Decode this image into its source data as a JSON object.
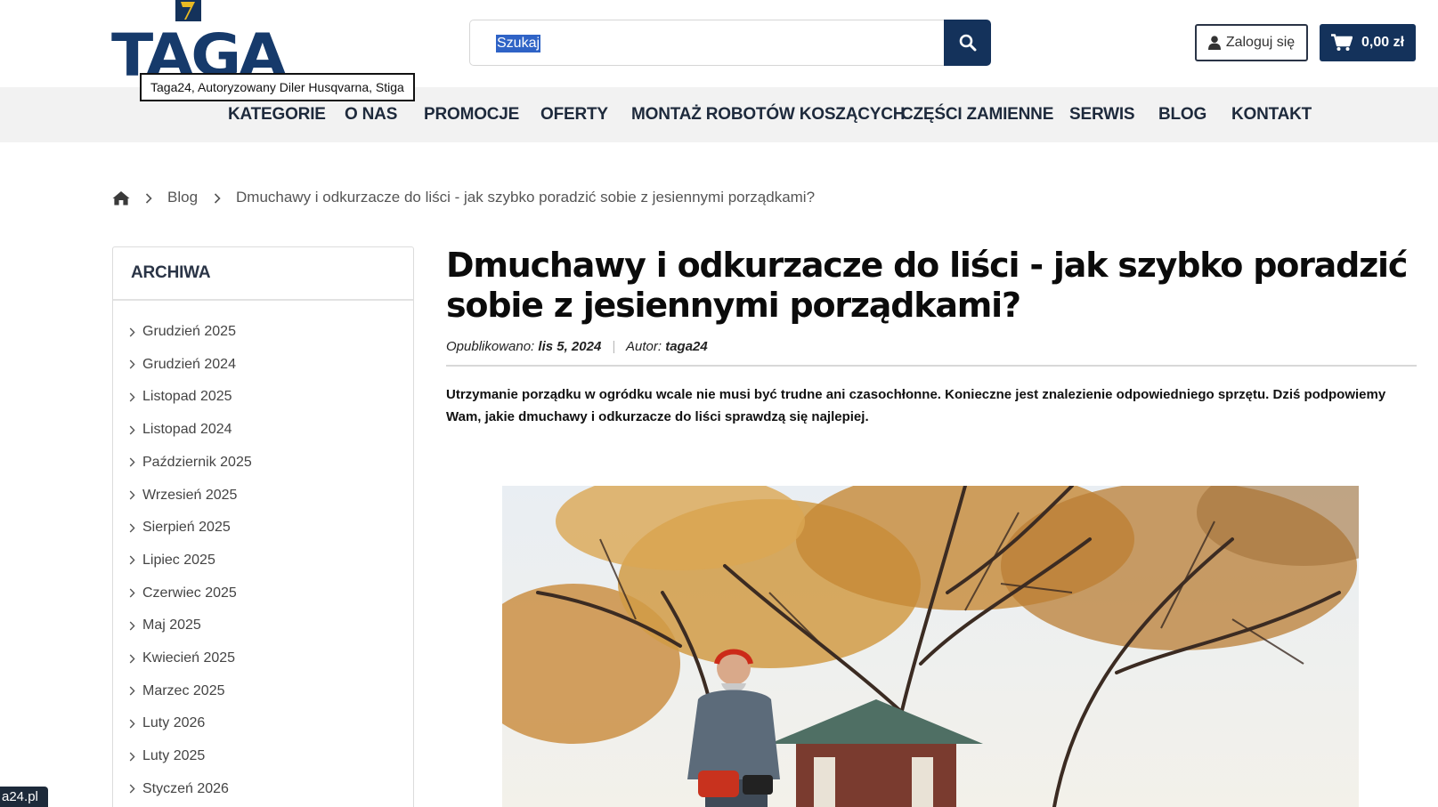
{
  "header": {
    "logo_text": "TAGA",
    "logo_tooltip": "Taga24, Autoryzowany Diler Husqvarna, Stiga",
    "search_placeholder": "Szukaj",
    "login_label": "Zaloguj się",
    "cart_total": "0,00 zł"
  },
  "nav": {
    "items": [
      "KATEGORIE",
      "O NAS",
      "PROMOCJE",
      "OFERTY",
      "MONTAŻ ROBOTÓW KOSZĄCYCH",
      "CZĘŚCI ZAMIENNE",
      "SERWIS",
      "BLOG",
      "KONTAKT"
    ]
  },
  "breadcrumb": {
    "blog": "Blog",
    "current": "Dmuchawy i odkurzacze do liści - jak szybko poradzić sobie z jesiennymi porządkami?"
  },
  "sidebar": {
    "title": "ARCHIWA",
    "items": [
      "Grudzień 2025",
      "Grudzień 2024",
      "Listopad 2025",
      "Listopad 2024",
      "Październik 2025",
      "Wrzesień 2025",
      "Sierpień 2025",
      "Lipiec 2025",
      "Czerwiec 2025",
      "Maj 2025",
      "Kwiecień 2025",
      "Marzec 2025",
      "Luty 2026",
      "Luty 2025",
      "Styczeń 2026"
    ]
  },
  "article": {
    "title": "Dmuchawy i odkurzacze do liści - jak szybko poradzić sobie z jesiennymi porządkami?",
    "published_label": "Opublikowano:",
    "published_date": "lis 5, 2024",
    "author_label": "Autor:",
    "author": "taga24",
    "intro": "Utrzymanie porządku w ogródku wcale nie musi być trudne ani czasochłonne. Konieczne jest znalezienie odpowiedniego sprzętu. Dziś podpowiemy Wam, jakie dmuchawy i odkurzacze do liści sprawdzą się najlepiej."
  },
  "status_url": "a24.pl",
  "colors": {
    "brand": "#14325b",
    "accent_gold": "#e8b923",
    "nav_bg": "#f2f2f2"
  },
  "icons": {
    "search": "search-icon",
    "user": "user-icon",
    "cart": "cart-icon",
    "home": "home-icon",
    "chevron": "chevron-right-icon"
  }
}
